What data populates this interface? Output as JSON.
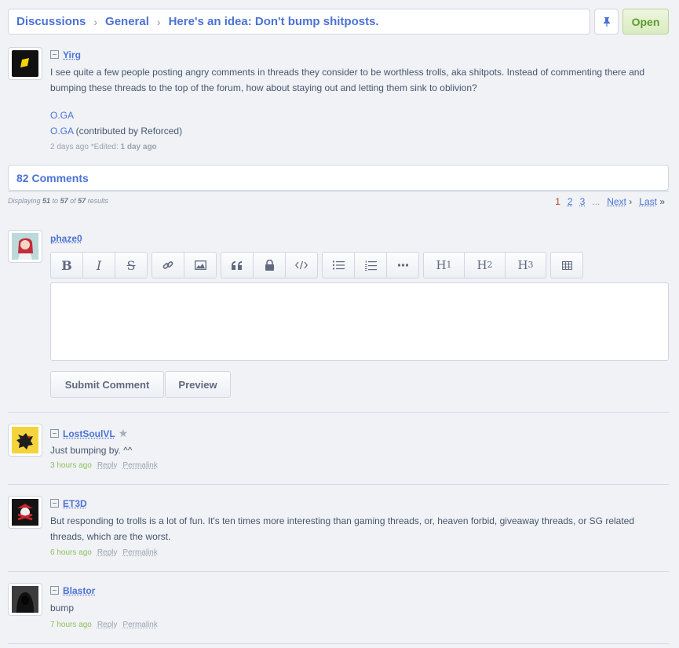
{
  "breadcrumb": {
    "items": [
      "Discussions",
      "General",
      "Here's an idea: Don't bump shitposts."
    ]
  },
  "open_label": "Open",
  "op": {
    "username": "Yirg",
    "body": "I see quite a few people posting angry comments in threads they consider to be worthless trolls, aka shitpots. Instead of commenting there and bumping these threads to the top of the forum, how about staying out and letting them sink to oblivion?",
    "link1": "O.GA",
    "link2": "O.GA",
    "link2_suffix": " (contributed by Reforced)",
    "time": "2 days ago",
    "edited": "*Edited: ",
    "edited_time": "1 day ago"
  },
  "comments_header": "82 Comments",
  "displaying": {
    "prefix": "Displaying ",
    "from": "51",
    "to_word": " to ",
    "to": "57",
    "of_word": " of ",
    "total": "57",
    "suffix": " results"
  },
  "pagination": {
    "pages": [
      "1",
      "2",
      "3"
    ],
    "dots": "...",
    "next": "Next",
    "last": "Last"
  },
  "editor": {
    "username": "phaze0",
    "h1": "H",
    "h2": "H",
    "h3": "H",
    "h1n": "1",
    "h2n": "2",
    "h3n": "3",
    "bold": "B",
    "italic": "I",
    "strike": "S",
    "submit": "Submit Comment",
    "preview": "Preview"
  },
  "comments": [
    {
      "username": "LostSoulVL",
      "body": "Just bumping by. ^^",
      "time": "3 hours ago",
      "reply": "Reply",
      "permalink": "Permalink"
    },
    {
      "username": "ET3D",
      "body": "But responding to trolls is a lot of fun. It's ten times more interesting than gaming threads, or, heaven forbid, giveaway threads, or SG related threads, which are the worst.",
      "time": "6 hours ago",
      "reply": "Reply",
      "permalink": "Permalink"
    },
    {
      "username": "Blastor",
      "body": "bump",
      "time": "7 hours ago",
      "reply": "Reply",
      "permalink": "Permalink"
    }
  ],
  "colors": {
    "link": "#4b72d4",
    "accent_green": "#5b9a2d",
    "current_page": "#c0392b",
    "fresh_time": "#8fc05e"
  }
}
